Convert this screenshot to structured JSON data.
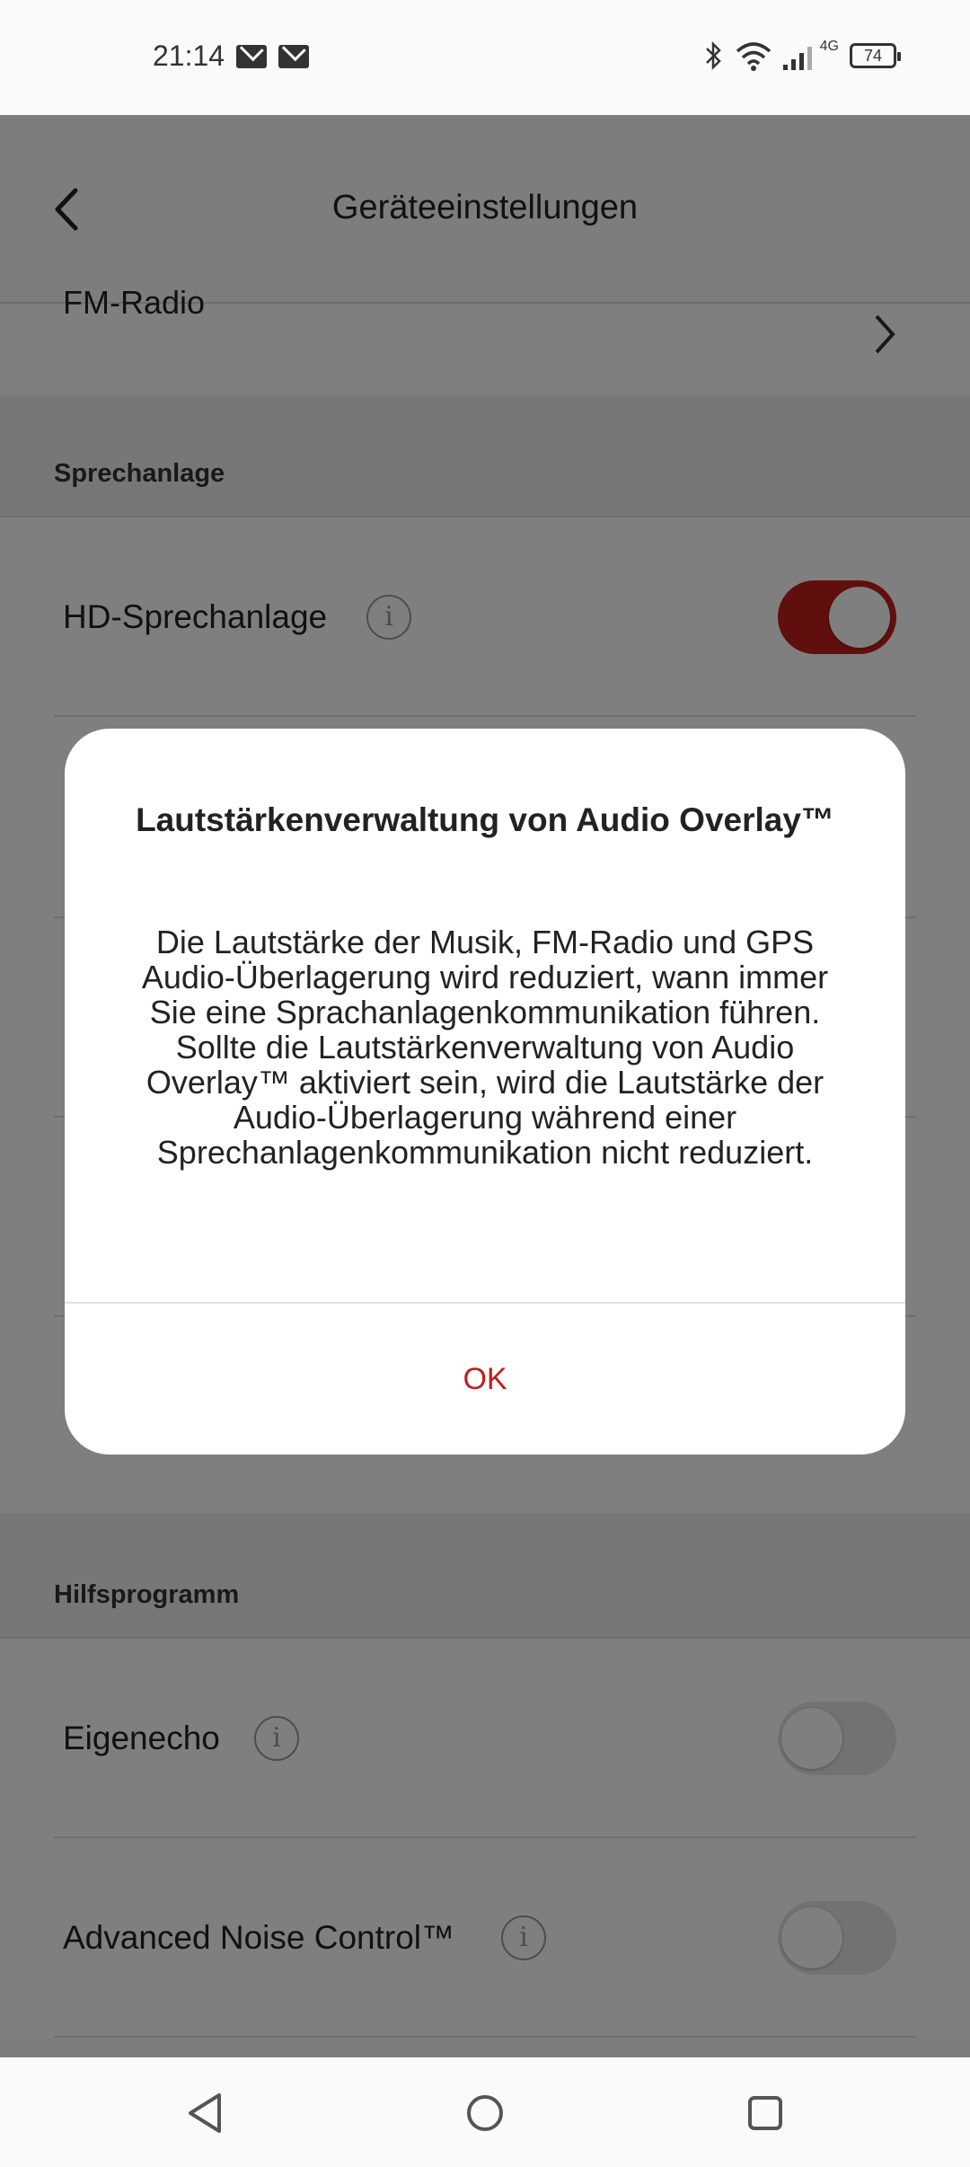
{
  "status_bar": {
    "time": "21:14",
    "icons": [
      "mail-icon",
      "mail-icon",
      "bluetooth-icon",
      "wifi-icon",
      "signal-icon"
    ],
    "network": "4G",
    "battery": "74"
  },
  "header": {
    "title": "Geräteeinstellungen",
    "back_icon": "chevron-left-icon"
  },
  "partial_row": {
    "label": "FM-Radio"
  },
  "sections": {
    "intercom": {
      "title": "Sprechanlage",
      "hd_intercom": {
        "label": "HD-Sprechanlage",
        "enabled": true
      }
    },
    "utility": {
      "title": "Hilfsprogramm",
      "sidetone": {
        "label": "Eigenecho",
        "enabled": false
      },
      "anc": {
        "label": "Advanced Noise Control™",
        "enabled": false
      }
    }
  },
  "dialog": {
    "title": "Lautstärkenverwaltung von Audio Overlay™",
    "body": "Die Lautstärke der Musik, FM-Radio und GPS Audio-Überlagerung wird reduziert, wann immer Sie eine Sprachanlagenkommunikation führen. Sollte die Lautstärkenverwaltung von Audio Overlay™ aktiviert sein, wird die Lautstärke der Audio-Überlagerung während einer Sprechanlagenkommunikation nicht reduziert.",
    "ok_label": "OK"
  },
  "nav_bar": {
    "back_icon": "triangle-back-icon",
    "home_icon": "circle-home-icon",
    "recents_icon": "square-recents-icon"
  },
  "colors": {
    "accent": "#c21d1d",
    "scrim": "rgba(0,0,0,0.5)"
  }
}
